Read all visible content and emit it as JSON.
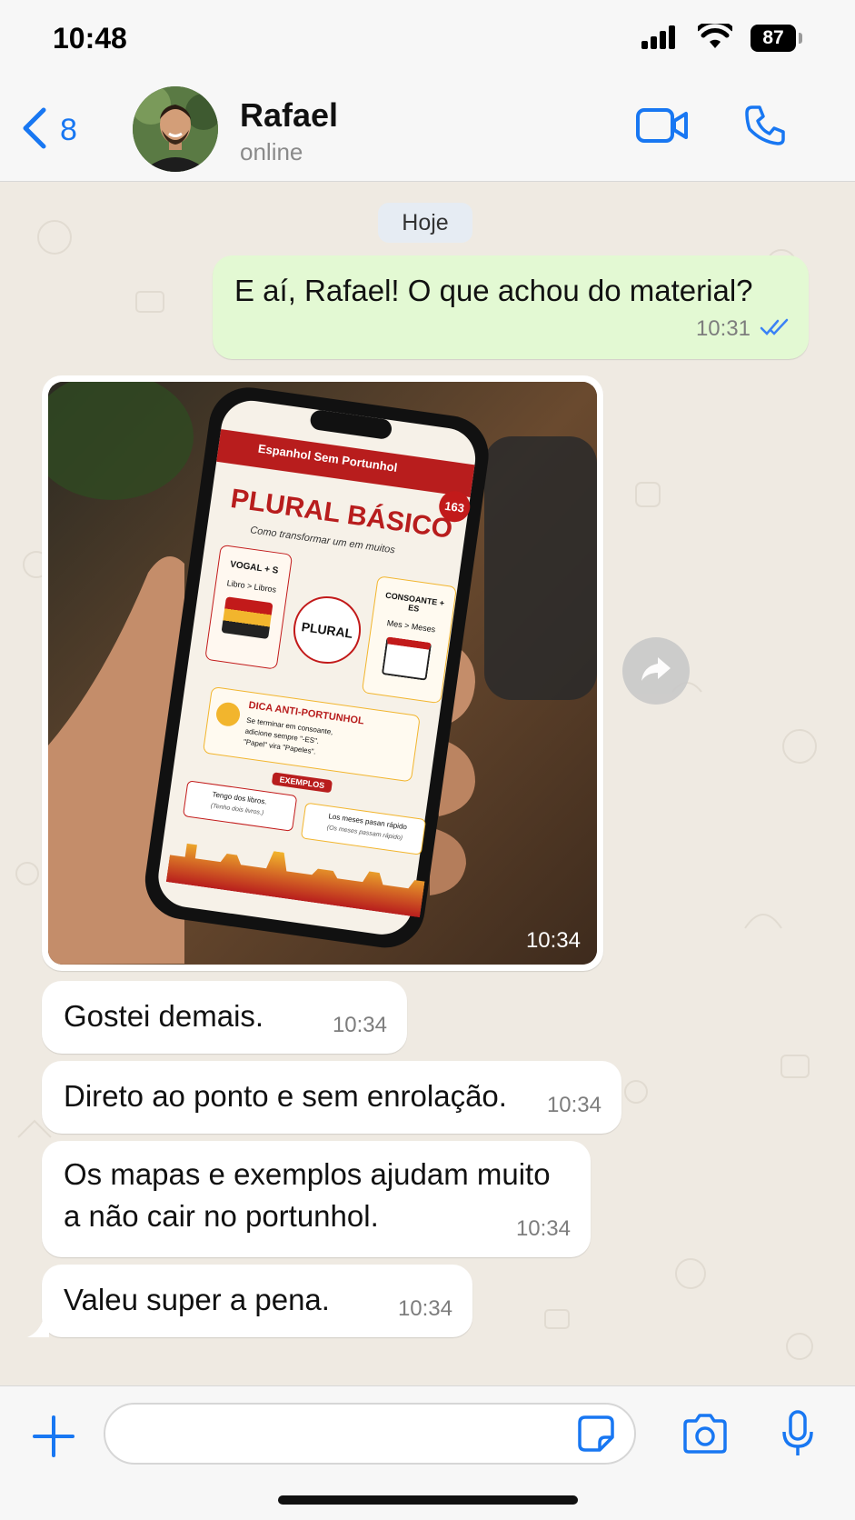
{
  "status_bar": {
    "time": "10:48",
    "battery": "87"
  },
  "header": {
    "back_count": "8",
    "contact_name": "Rafael",
    "contact_status": "online"
  },
  "chat": {
    "date_label": "Hoje",
    "messages": [
      {
        "direction": "out",
        "text": "E aí, Rafael! O que achou do material?",
        "time": "10:31"
      },
      {
        "direction": "in",
        "type": "image",
        "time": "10:34"
      },
      {
        "direction": "in",
        "text": "Gostei demais.",
        "time": "10:34"
      },
      {
        "direction": "in",
        "text": "Direto ao ponto e sem enrolação.",
        "time": "10:34"
      },
      {
        "direction": "in",
        "text": "Os mapas e exemplos ajudam muito a não cair no portunhol.",
        "time": "10:34"
      },
      {
        "direction": "in",
        "text": "Valeu super a pena.",
        "time": "10:34"
      }
    ]
  },
  "image_content": {
    "brand": "Espanhol Sem Portunhol",
    "badge": "163",
    "title": "PLURAL BÁSICO",
    "subtitle": "Como transformar um em muitos",
    "rule1_title": "VOGAL + S",
    "rule1_example": "Libro > Libros",
    "center": "PLURAL",
    "rule2_title": "CONSOANTE + ES",
    "rule2_example": "Mes > Meses",
    "tip_title": "DICA ANTI-PORTUNHOL",
    "tip_text_1": "Se terminar em consoante,",
    "tip_text_2": "adicione sempre \"-ES\".",
    "tip_text_3": "\"Papel\" vira \"Papeles\".",
    "examples_label": "EXEMPLOS",
    "example1": "Tengo dos libros.",
    "example1_sub": "(Tenho dois livros.)",
    "example2": "Los meses pasan rápido",
    "example2_sub": "(Os meses passam rápido)"
  },
  "input": {
    "placeholder": ""
  },
  "colors": {
    "accent": "#1877f2",
    "outgoing": "#e3f9d3",
    "incoming": "#ffffff",
    "wallpaper": "#efeae2"
  }
}
